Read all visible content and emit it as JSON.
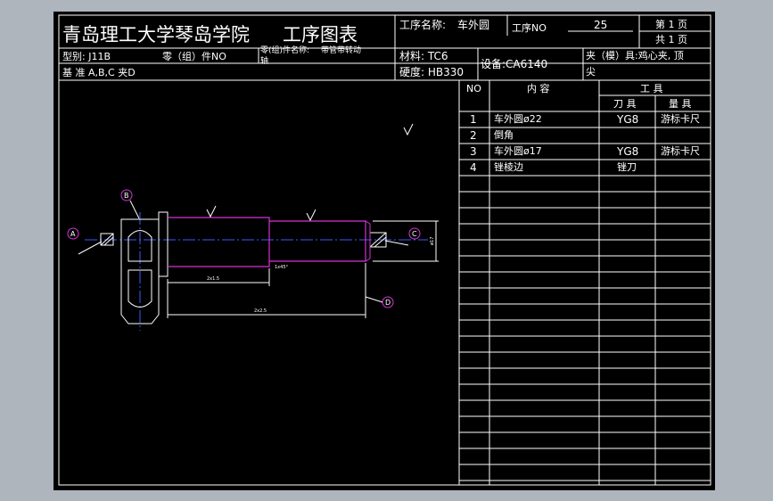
{
  "title_block": {
    "school": "青岛理工大学琴岛学院",
    "doc_title": "工序图表",
    "process_name_label": "工序名称:",
    "process_name": "车外圆",
    "process_no_label": "工序NO",
    "process_no": "25",
    "page_label": "第 1 页",
    "total_label": "共 1 页",
    "model": "型别: J11B",
    "part_no_label": "零（组）件NO",
    "part_name_label": "零(组)件名称:",
    "part_name_line1": "带管带转动",
    "part_name_line2": "轴",
    "material": "材料: TC6",
    "hardness": "硬度: HB330",
    "equipment": "设备:CA6140",
    "fixture_line1": "夹（模）具:鸡心夹, 顶",
    "fixture_line2": "尖",
    "datum": "基 准 A,B,C 夹D"
  },
  "op_table": {
    "col_no": "NO",
    "col_content": "内 容",
    "col_tools": "工 具",
    "col_cutter": "刀 具",
    "col_gauge": "量 具",
    "rows": [
      {
        "no": "1",
        "content": "车外圆ø22",
        "cutter": "YG8",
        "gauge": "游标卡尺"
      },
      {
        "no": "2",
        "content": "倒角",
        "cutter": "",
        "gauge": ""
      },
      {
        "no": "3",
        "content": "车外圆ø17",
        "cutter": "YG8",
        "gauge": "游标卡尺"
      },
      {
        "no": "4",
        "content": "锉棱边",
        "cutter": "锉刀",
        "gauge": ""
      }
    ]
  },
  "drawing": {
    "labels": {
      "A": "A",
      "B": "B",
      "C": "C",
      "D": "D"
    },
    "dim_len_1": "2x1.5",
    "dim_len_2": "2x2.5",
    "dim_chamfer": "1x45°",
    "dim_dia": "ø17"
  },
  "colors": {
    "background": "#aeb5bd",
    "sheet": "#000000",
    "line": "#ffffff",
    "part": "#d633d6",
    "center": "#3a5bff"
  }
}
